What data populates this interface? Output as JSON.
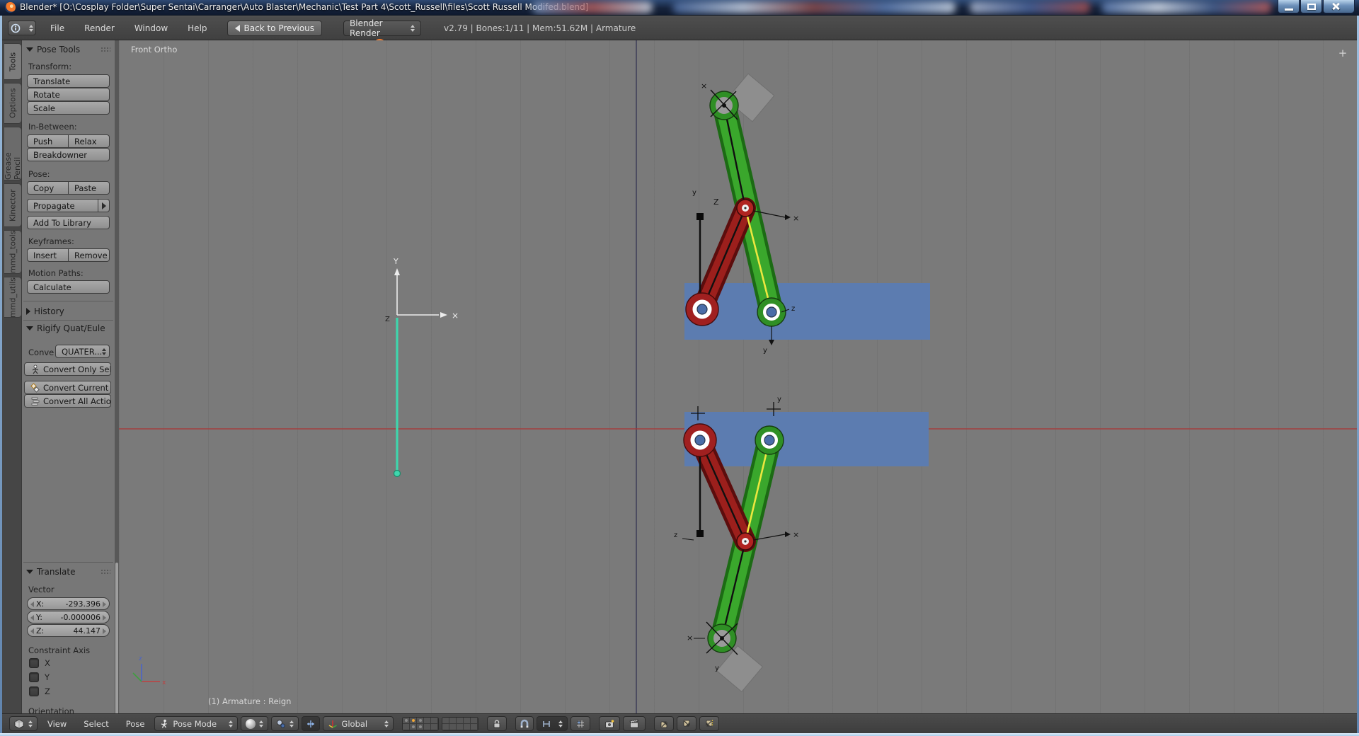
{
  "window": {
    "title": "Blender* [O:\\Cosplay Folder\\Super Sentai\\Carranger\\Auto Blaster\\Mechanic\\Test Part 4\\Scott_Russell\\files\\Scott Russell Modifed.blend]",
    "controls": [
      "minimize",
      "maximize",
      "close"
    ]
  },
  "menubar": {
    "menus": [
      "File",
      "Render",
      "Window",
      "Help"
    ],
    "back_button": "Back to Previous",
    "engine": "Blender Render",
    "status": "v2.79 | Bones:1/11  | Mem:51.62M | Armature"
  },
  "toolshelf": {
    "tabs": [
      "Tools",
      "Options",
      "Grease Pencil",
      "Kinector",
      "mmd_tools",
      "mmd_utils"
    ],
    "pose_tools": {
      "header": "Pose Tools",
      "transform_label": "Transform:",
      "translate": "Translate",
      "rotate": "Rotate",
      "scale": "Scale",
      "inbetween_label": "In-Between:",
      "push": "Push",
      "relax": "Relax",
      "breakdowner": "Breakdowner",
      "pose_label": "Pose:",
      "copy": "Copy",
      "paste": "Paste",
      "propagate": "Propagate",
      "add_to_library": "Add To Library",
      "keyframes_label": "Keyframes:",
      "insert": "Insert",
      "remove": "Remove",
      "motion_label": "Motion Paths:",
      "calculate": "Calculate"
    },
    "history_header": "History",
    "rigify": {
      "header": "Rigify Quat/Euler Co",
      "convert_label": "Conve",
      "mode_value": "QUATER...",
      "only_selected": "Convert Only Sele...",
      "current_action": "Convert Current A...",
      "all_actions": "Convert All Actions"
    },
    "translate_panel": {
      "header": "Translate",
      "vector_label": "Vector",
      "x_label": "X:",
      "x_value": "-293.396",
      "y_label": "Y:",
      "y_value": "-0.000006",
      "z_label": "Z:",
      "z_value": "44.147",
      "constraint_label": "Constraint Axis",
      "axes": [
        "X",
        "Y",
        "Z"
      ],
      "orientation_label": "Orientation"
    }
  },
  "viewport": {
    "view_label": "Front Ortho",
    "object_label": "(1) Armature : Reign",
    "labels": {
      "X": "Y",
      "x_axis": "×",
      "z": "Z",
      "zl": "z",
      "yl": "y",
      "xl": "x",
      "times": "×",
      "plus": "+"
    },
    "colors": {
      "background": "#7a7a7a",
      "blue_block": "#5c7cb0",
      "bone_green": "#3aa72c",
      "bone_green_edge": "#1c6b14",
      "bone_red": "#9c1f1c",
      "bone_red_edge": "#5c0d0d",
      "selected_yellow": "#ece73f",
      "bone_teal": "#3fd6ad",
      "joint_blue": "#4a6da8",
      "axis_red": "#aa3434",
      "axis_dark": "#3c3c58"
    }
  },
  "footer": {
    "menus": [
      "View",
      "Select",
      "Pose"
    ],
    "mode": "Pose Mode",
    "orientation": "Global",
    "icons": [
      "editor-type",
      "pose-mode-run",
      "viewport-shading-sphere",
      "pivot-center",
      "manipulator-arrows",
      "orientation-axis",
      "layers-grid-1",
      "layers-grid-2",
      "lock",
      "snap-magnet",
      "proportional-edit",
      "snap-element",
      "render-opengl-camera",
      "render-anim-clapper",
      "copy-pose",
      "paste-pose",
      "paste-flipped-pose"
    ]
  }
}
